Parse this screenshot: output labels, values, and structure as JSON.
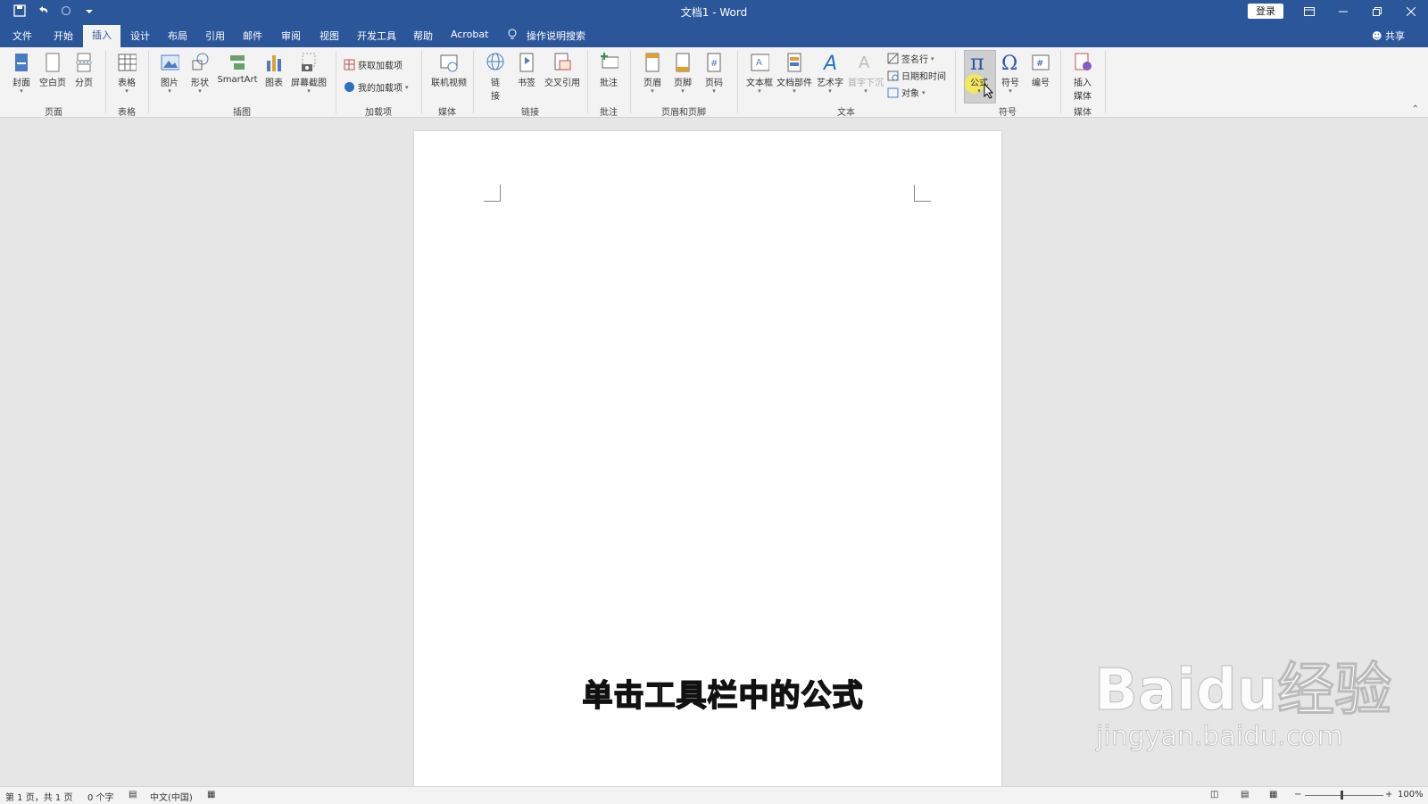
{
  "window": {
    "title": "文档1 - Word",
    "login_label": "登录",
    "share_label": "共享"
  },
  "tabs": [
    "文件",
    "开始",
    "插入",
    "设计",
    "布局",
    "引用",
    "邮件",
    "审阅",
    "视图",
    "开发工具",
    "帮助",
    "Acrobat"
  ],
  "active_tab": "插入",
  "tell_me": "操作说明搜索",
  "ribbon": {
    "groups": {
      "pages": "页面",
      "tables": "表格",
      "illustrations": "插图",
      "addins": "加载项",
      "media": "媒体",
      "links": "链接",
      "comments": "批注",
      "header_footer": "页眉和页脚",
      "text": "文本",
      "symbols": "符号",
      "media2": "媒体"
    },
    "buttons": {
      "cover": "封面",
      "blank": "空白页",
      "pagebreak": "分页",
      "table": "表格",
      "picture": "图片",
      "shapes": "形状",
      "smartart": "SmartArt",
      "chart": "图表",
      "screenshot": "屏幕截图",
      "get_addins": "获取加载项",
      "my_addins": "我的加载项",
      "online_video": "联机视频",
      "link_1": "链",
      "link_2": "接",
      "bookmark": "书签",
      "crossref": "交叉引用",
      "comment": "批注",
      "header": "页眉",
      "footer": "页脚",
      "pagenum": "页码",
      "textbox": "文本框",
      "quickparts": "文档部件",
      "wordart": "艺术字",
      "dropcap": "首字下沉",
      "signature": "签名行",
      "datetime": "日期和时间",
      "object": "对象",
      "equation": "公式",
      "symbol": "符号",
      "number": "编号",
      "insert_media_1": "插入",
      "insert_media_2": "媒体"
    }
  },
  "document": {
    "caption": "单击工具栏中的公式"
  },
  "status": {
    "page": "第 1 页，共 1 页",
    "words": "0 个字",
    "language": "中文(中国)",
    "zoom": "100%"
  },
  "watermark": {
    "brand": "Baidu经验",
    "url": "jingyan.baidu.com"
  }
}
